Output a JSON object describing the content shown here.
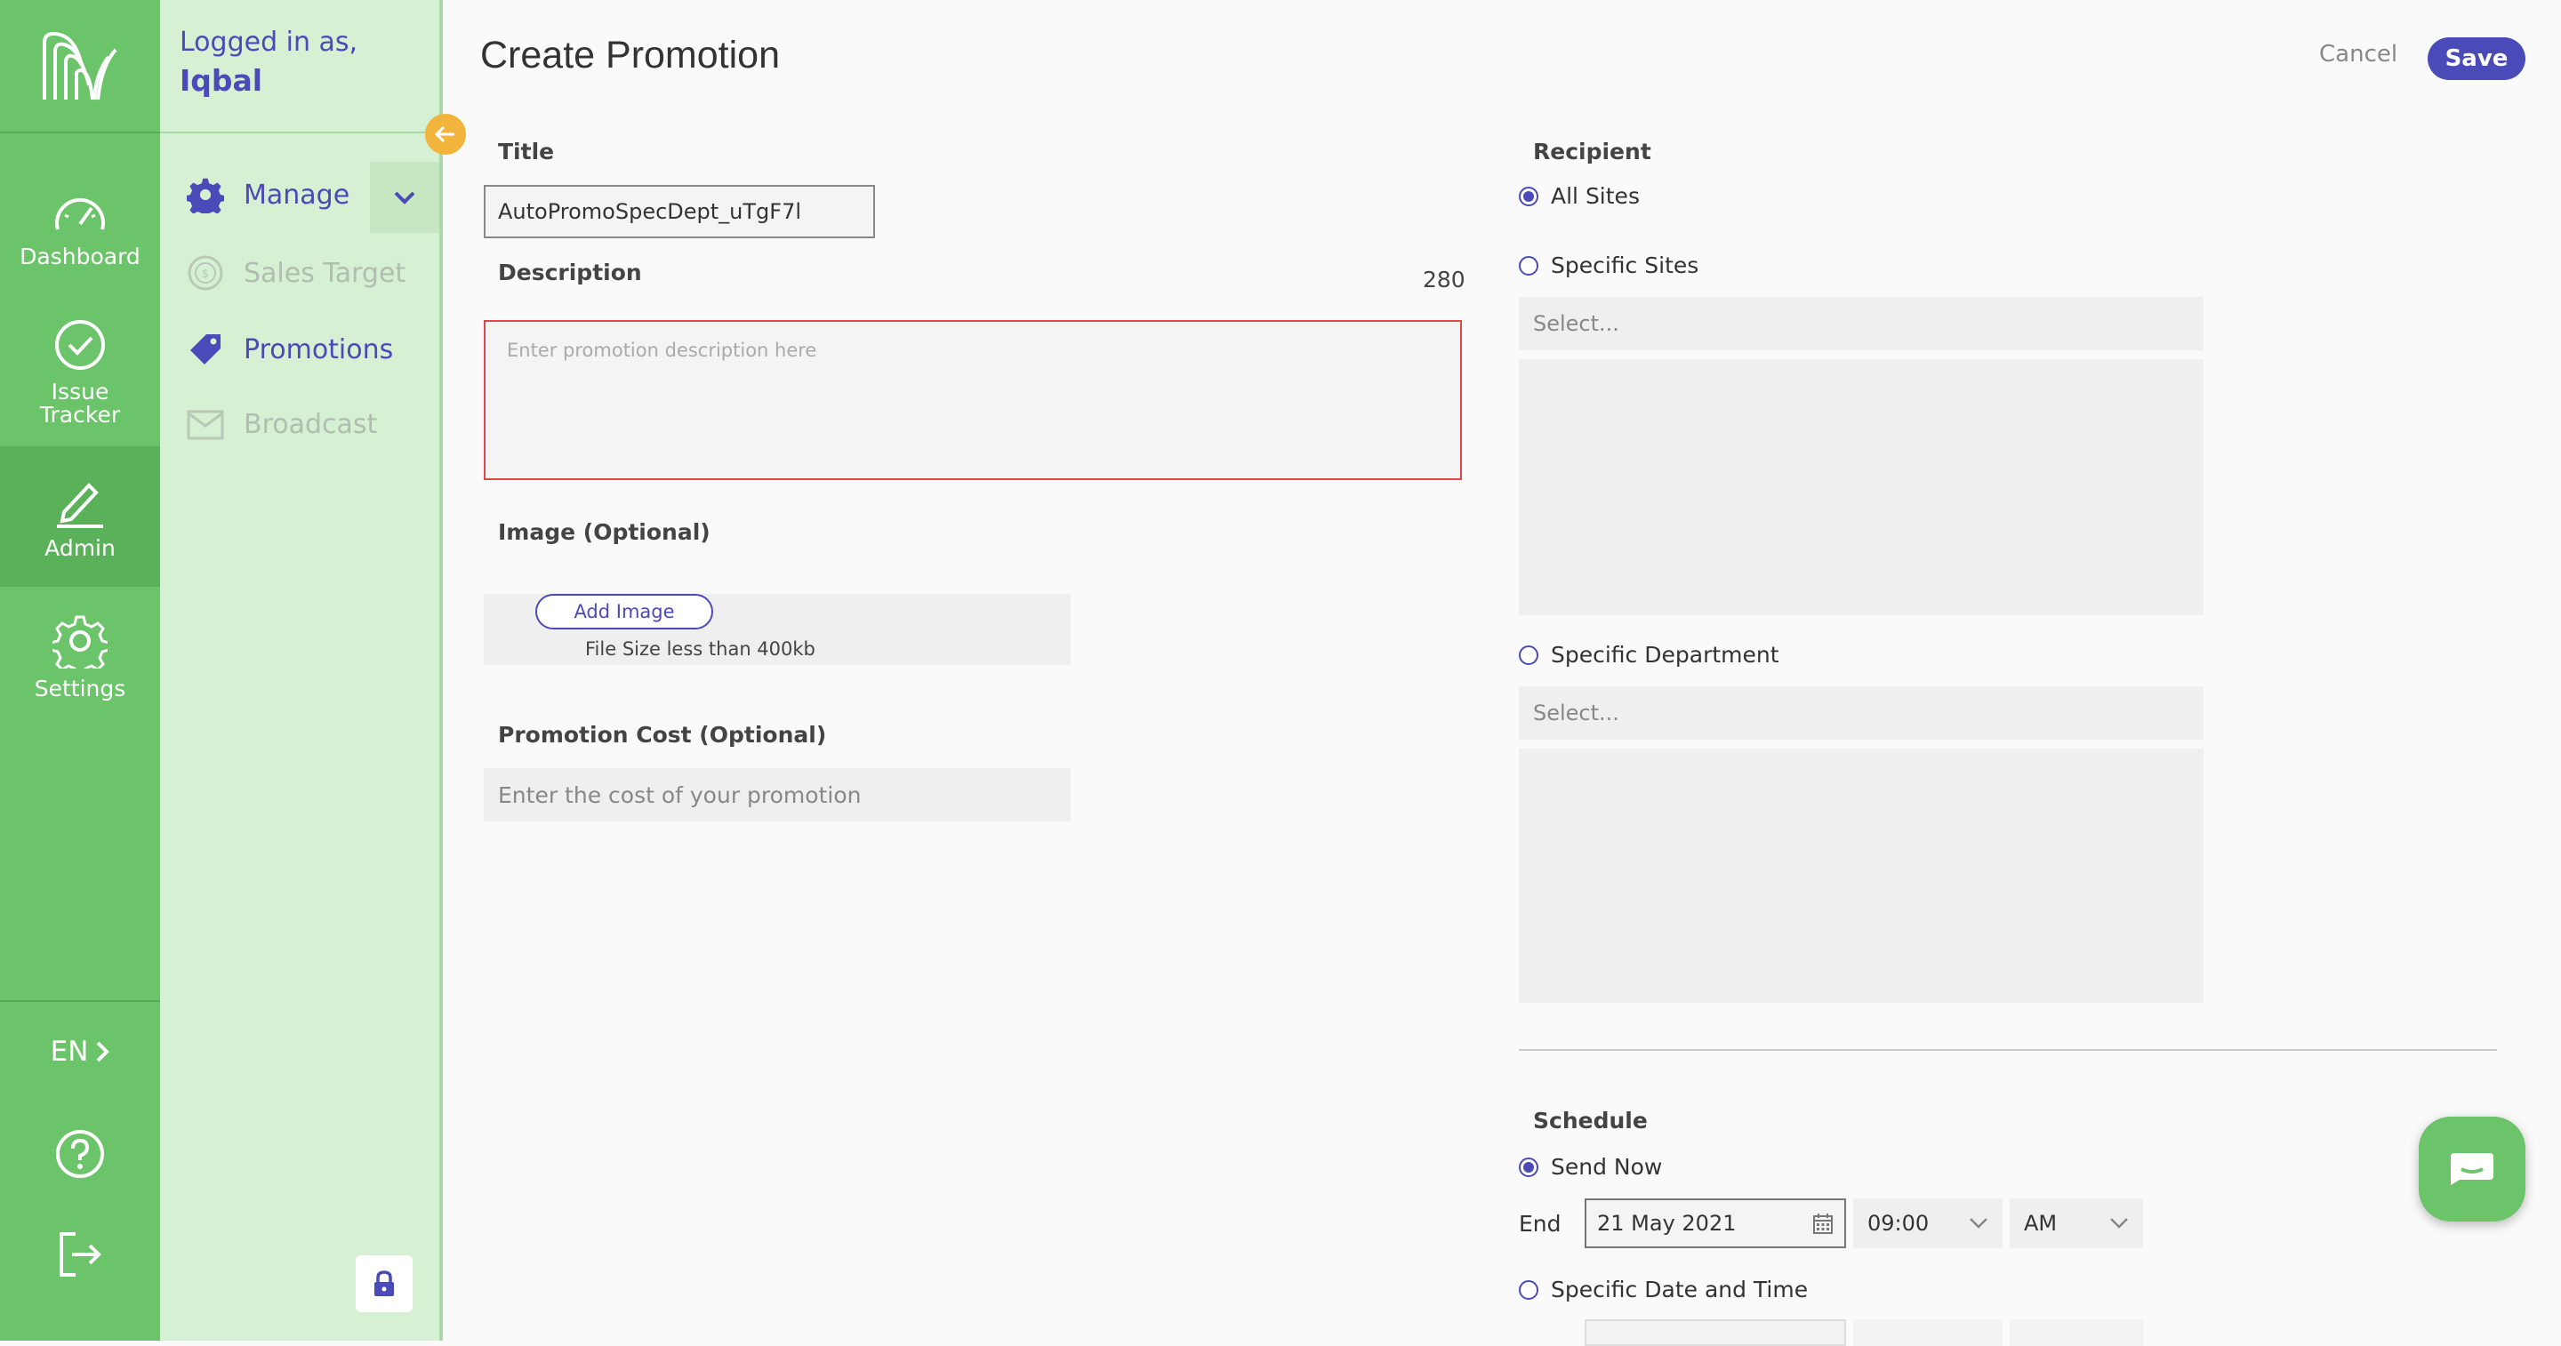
{
  "nav": {
    "items": [
      {
        "label": "Dashboard",
        "icon": "gauge-icon"
      },
      {
        "label": "Issue\nTracker",
        "icon": "check-circle-icon"
      },
      {
        "label": "Admin",
        "icon": "pencil-icon"
      },
      {
        "label": "Settings",
        "icon": "gear-icon"
      }
    ],
    "language": "EN"
  },
  "user": {
    "prefix": "Logged in as,",
    "name": "Iqbal"
  },
  "submenu": {
    "manage": "Manage",
    "items": [
      {
        "label": "Sales Target",
        "enabled": false
      },
      {
        "label": "Promotions",
        "enabled": true
      },
      {
        "label": "Broadcast",
        "enabled": false
      }
    ]
  },
  "header": {
    "title": "Create Promotion",
    "cancel": "Cancel",
    "save": "Save"
  },
  "form": {
    "title_label": "Title",
    "title_value": "AutoPromoSpecDept_uTgF7l",
    "description_label": "Description",
    "char_count": "280",
    "description_placeholder": "Enter promotion description here",
    "image_label": "Image (Optional)",
    "add_image": "Add Image",
    "file_note": "File Size less than 400kb",
    "cost_label": "Promotion Cost (Optional)",
    "cost_placeholder": "Enter the cost of your promotion"
  },
  "recipient": {
    "label": "Recipient",
    "all_sites": "All Sites",
    "specific_sites": "Specific Sites",
    "specific_sites_placeholder": "Select...",
    "specific_department": "Specific Department",
    "specific_department_placeholder": "Select...",
    "selected": "All Sites"
  },
  "schedule": {
    "label": "Schedule",
    "send_now": "Send Now",
    "end_label": "End",
    "end_date": "21 May 2021",
    "end_time": "09:00",
    "end_period": "AM",
    "specific": "Specific Date and Time",
    "selected": "Send Now"
  },
  "colors": {
    "accent": "#4a4ab8",
    "green": "#6cc46a",
    "error": "#e04848",
    "collapse": "#f2b43c"
  }
}
